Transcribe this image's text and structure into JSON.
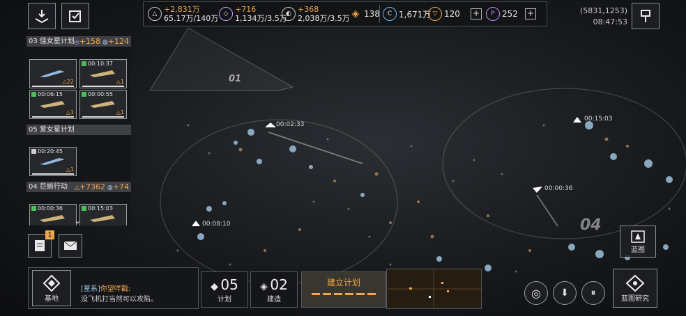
{
  "resources": [
    {
      "icon": "credits-icon",
      "delta": "+2,831万",
      "amount": "65.17万/140万"
    },
    {
      "icon": "crystal-icon",
      "delta": "+716",
      "amount": "1,134万/3.5万"
    },
    {
      "icon": "gas-icon",
      "delta": "+368",
      "amount": "2,038万/3.5万"
    }
  ],
  "single_resources": {
    "alloy": "138",
    "energy": "1,671万",
    "token": "120",
    "premium": "252"
  },
  "coordinates": "(5831,1253)",
  "clock": "08:47:53",
  "plans": {
    "p03": {
      "title": "03 佳女星计划",
      "gain1": "+158",
      "gain2": "+124",
      "cards": [
        {
          "time": "",
          "level": "22"
        },
        {
          "time": "00:10:37",
          "level": "1"
        },
        {
          "time": "00:06:15",
          "level": "1"
        },
        {
          "time": "00:00:55",
          "level": "1"
        }
      ]
    },
    "p05": {
      "title": "05 爱女星计划",
      "cards": [
        {
          "time": "00:20:45",
          "level": "1"
        }
      ]
    },
    "p04": {
      "title": "04 巨蜥行动",
      "gain1": "+7362",
      "gain2": "+74",
      "cards": [
        {
          "time": "00:00:36",
          "level": ""
        },
        {
          "time": "00:15:03",
          "level": ""
        }
      ]
    }
  },
  "map": {
    "zone_a": "01",
    "zone_b": "04",
    "timers": {
      "t1": "00:02:33",
      "t2": "00:15:03",
      "t3": "00:00:36",
      "t4": "00:08:10"
    }
  },
  "mail_badge": "1",
  "bottom": {
    "base_label": "基地",
    "chat_channel": "[星系]",
    "chat_name": "你望咩戳:",
    "chat_text": "没飞机打当然可以攻陷。",
    "plan_count": "05",
    "plan_label": "计划",
    "build_count": "02",
    "build_label": "建造",
    "create_plan": "建立计划",
    "blueprint_label": "蓝图",
    "blueprint_research": "蓝图研究"
  },
  "colors": {
    "accent": "#f0a64a",
    "panel": "#16171a",
    "green": "#4dbd5a"
  }
}
